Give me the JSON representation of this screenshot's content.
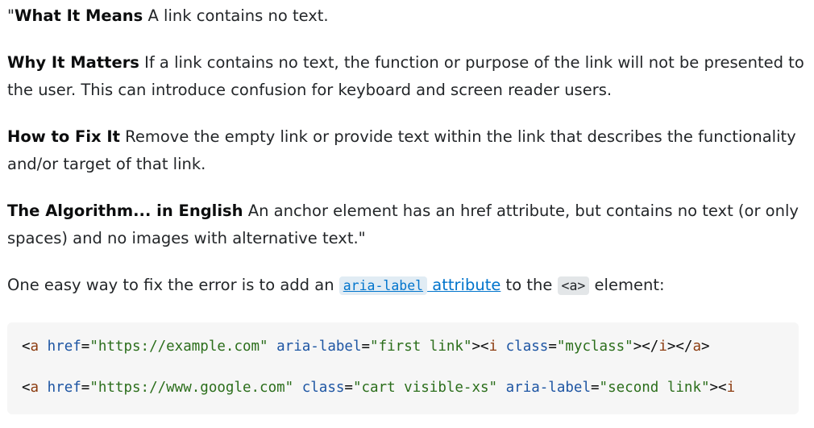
{
  "paragraphs": [
    {
      "lead_quote": "\"",
      "bold": "What It Means",
      "text": " A link contains no text."
    },
    {
      "bold": "Why It Matters",
      "text": " If a link contains no text, the function or purpose of the link will not be presented to the user. This can introduce confusion for keyboard and screen reader users."
    },
    {
      "bold": "How to Fix It",
      "text": " Remove the empty link or provide text within the link that describes the functionality and/or target of that link."
    },
    {
      "bold": "The Algorithm... in English",
      "text": " An anchor element has an href attribute, but contains no text (or only spaces) and no images with alternative text.\""
    }
  ],
  "fix_sentence": {
    "before": "One easy way to fix the error is to add an ",
    "link_code": "aria-label",
    "link_text": " attribute",
    "middle": " to the ",
    "inline_code": "<a>",
    "after": " element:"
  },
  "code_block": {
    "line1": {
      "lt": "<",
      "tag": "a",
      "attr1": " href",
      "eq1": "=",
      "val1": "\"https://example.com\"",
      "attr2": " aria-label",
      "eq2": "=",
      "val2": "\"first link\"",
      "close1": "><",
      "tag2": "i",
      "attr3": " class",
      "eq3": "=",
      "val3": "\"myclass\"",
      "close2": "></",
      "tag3": "i",
      "close3": "></",
      "tag4": "a",
      "close4": ">"
    },
    "line2": {
      "lt": "<",
      "tag": "a",
      "attr1": " href",
      "eq1": "=",
      "val1": "\"https://www.google.com\"",
      "attr2": " class",
      "eq2": "=",
      "val2": "\"cart visible-xs\"",
      "attr3": " aria-label",
      "eq3": "=",
      "val3": "\"second link\"",
      "close1": "><",
      "tag2": "i"
    }
  }
}
